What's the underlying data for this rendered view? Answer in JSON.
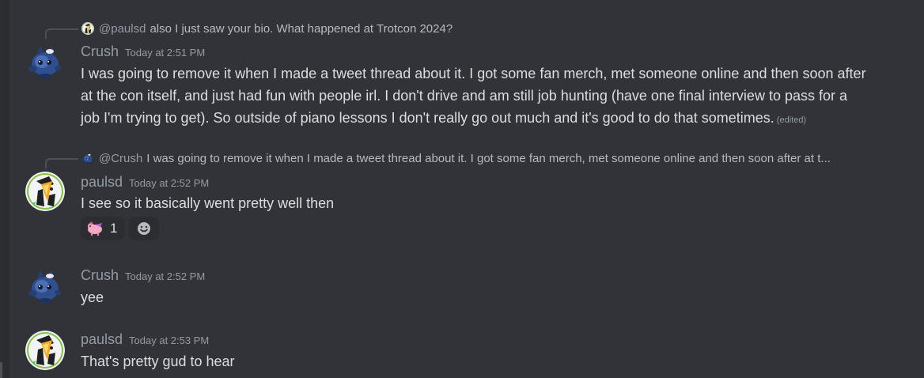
{
  "colors": {
    "background": "#313338",
    "username": "#949ba4",
    "message_text": "#dbdee1",
    "reply_text": "#b5bac1",
    "reaction_bg": "#2b2d31"
  },
  "messages": [
    {
      "reply": {
        "mention": "@paulsd",
        "text": "also I just saw your bio. What happened at Trotcon 2024?"
      },
      "username": "Crush",
      "timestamp": "Today at 2:51 PM",
      "lines": [
        "I was going to remove it when I made a tweet thread about it. I got some fan merch, met someone online and then soon after",
        "at the con itself, and just had fun with people irl. I don't drive and am still job hunting (have one final interview to pass for a",
        "job I'm trying to get). So outside of piano lessons I don't really go out much and it's good to do that sometimes."
      ],
      "edited": "(edited)",
      "avatar_icon": "blue-creature-avatar"
    },
    {
      "reply": {
        "mention": "@Crush",
        "text": "I was going to remove it when I made a tweet thread about it. I got some fan merch, met someone online and then soon after at t..."
      },
      "username": "paulsd",
      "timestamp": "Today at 2:52 PM",
      "text": "I see so it basically went pretty well then",
      "reactions": [
        {
          "emoji": "pink-pony-emoji",
          "count": "1"
        }
      ],
      "add_reaction_icon": "smiley-add-reaction-icon",
      "avatar_icon": "dark-character-avatar"
    },
    {
      "username": "Crush",
      "timestamp": "Today at 2:52 PM",
      "text": "yee",
      "avatar_icon": "blue-creature-avatar"
    },
    {
      "username": "paulsd",
      "timestamp": "Today at 2:53 PM",
      "text": "That's pretty gud to hear",
      "avatar_icon": "dark-character-avatar"
    }
  ]
}
